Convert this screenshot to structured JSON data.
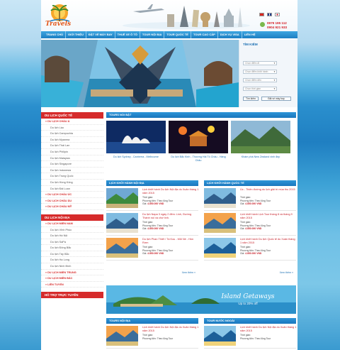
{
  "header": {
    "logo_text": "Travels",
    "hotline": [
      "0979 195 112",
      "0904 921 933"
    ]
  },
  "nav": [
    "TRANG CHỦ",
    "GIỚI THIỆU",
    "ĐẶT VÉ MÁY BAY",
    "THUÊ XE Ô TÔ",
    "TOUR NỘI ĐỊA",
    "TOUR QUỐC TẾ",
    "TOUR CAO CẤP",
    "DỊCH VỤ VISA",
    "LIÊN HỆ"
  ],
  "search": {
    "title": "TÌM KIẾM",
    "selects": [
      "Chọn điểm đi",
      "Chọn điểm khởi hành",
      "Chọn điểm đến",
      "Chọn thời gian"
    ],
    "search_label": "Tìm kiếm",
    "book_label": "Đặt vé máy bay"
  },
  "sidebar": {
    "international_title": "DU LỊCH QUỐC TẾ",
    "international": [
      {
        "label": "DU LỊCH CHÂU Á",
        "cat": true
      },
      {
        "label": "Du lịch Lào"
      },
      {
        "label": "Du lịch Campuchia"
      },
      {
        "label": "Du lịch Myanma"
      },
      {
        "label": "Du lịch Thái Lan"
      },
      {
        "label": "Du lịch Philipin"
      },
      {
        "label": "Du lịch Malaysia"
      },
      {
        "label": "Du lịch Singapore"
      },
      {
        "label": "Du lịch Indonesia"
      },
      {
        "label": "Du lịch Trung Quốc"
      },
      {
        "label": "Du lịch Hồng Kông"
      },
      {
        "label": "Du lịch Đài Loan"
      },
      {
        "label": "DU LỊCH CHÂU ÚC",
        "cat": true
      },
      {
        "label": "DU LỊCH CHÂU ÂU",
        "cat": true
      },
      {
        "label": "DU LỊCH CHÂU MỸ",
        "cat": true
      }
    ],
    "domestic_title": "DU LỊCH NỘI ĐỊA",
    "domestic": [
      {
        "label": "DU LỊCH MIỀN NAM",
        "cat": true
      },
      {
        "label": "Du lịch Vĩnh Phúc"
      },
      {
        "label": "Du lịch Hà Nội"
      },
      {
        "label": "Du lịch SaPa"
      },
      {
        "label": "Du lịch Đông Bắc"
      },
      {
        "label": "Du lịch Tây Bắc"
      },
      {
        "label": "Du lịch Hạ Long"
      },
      {
        "label": "Du lịch Ninh Bình"
      },
      {
        "label": "DU LỊCH MIỀN TRUNG",
        "cat": true
      },
      {
        "label": "DU LỊCH MIỀN BẮC",
        "cat": true
      },
      {
        "label": "LIÊN TUYẾN",
        "cat": true
      }
    ],
    "support_title": "HỖ TRỢ TRỰC TUYẾN"
  },
  "hot": {
    "title": "TOURS NỔI BẬT",
    "items": [
      {
        "caption": "Du lịch Sydney - Canberra - Melbourne"
      },
      {
        "caption": "Du lịch Bắc Kinh - Thượng Hải Tô Châu - Hàng Châu"
      },
      {
        "caption": "Khám phá New Zealand xinh đẹp"
      }
    ]
  },
  "col_left": {
    "title": "LỊCH KHỞI HÀNH NỘI ĐỊA",
    "items": [
      {
        "title": "Lịch khởi hành Du lịch Nội địa du Xuân tháng 1 năm 2015",
        "time": "Thời gian:",
        "transport": "Phương tiện: Theo lũng Tour",
        "price": "4.850.000 VND"
      },
      {
        "title": "Du lịch Napa 3 ngày 2 đêm: Linh, Đường Thành núi và chợ tình.",
        "time": "Thời gian:",
        "transport": "Phương tiện: Theo lũng Tour",
        "price": "4.850.000 VND"
      },
      {
        "title": "Du lịch Phan Thiết / Tà Kou - Mũi Né - Hòn Rơm",
        "time": "Thời gian:",
        "transport": "Phương tiện: Theo lũng Tour",
        "price": "4.850.000 VND"
      }
    ],
    "more": "Xem thêm »"
  },
  "col_right": {
    "title": "LỊCH KHỞI HÀNH QUỐC TẾ",
    "items": [
      {
        "title": "Úc - Thiên đường du lịch giải trí mùa thu 2015",
        "time": "Thời gian:",
        "transport": "Phương tiện: Theo lũng Tour",
        "price": "4.850.000 VND"
      },
      {
        "title": "Lịch khởi hành Lịch Tour tháng 8 và tháng 9 năm 2015",
        "time": "Thời gian:",
        "transport": "Phương tiện: Theo lũng Tour",
        "price": "4.850.000 VND"
      },
      {
        "title": "Lịch khởi hành Du lịch Quốc tế du Xuân tháng 1 năm 2015",
        "time": "Thời gian:",
        "transport": "Phương tiện: Theo lũng Tour",
        "price": "4.850.000 VND"
      }
    ],
    "more": "Xem thêm »"
  },
  "ad": {
    "title": "Island Getaways",
    "subtitle": "Up to 20% off"
  },
  "bottom_left": {
    "title": "TOURS NỘI ĐỊA",
    "items": [
      {
        "title": "Lịch khởi hành Du lịch Nội địa du Xuân tháng 1 năm 2015",
        "time": "Thời gian:",
        "transport": "Phương tiện: Theo lũng Tour"
      }
    ]
  },
  "bottom_right": {
    "title": "TOUR NƯỚC NGOÀI",
    "items": [
      {
        "title": "Lịch khởi hành Du lịch Nội địa du Xuân tháng 1 năm 2015",
        "time": "Thời gian:",
        "transport": "Phương tiện: Theo lũng Tour"
      }
    ]
  },
  "colors": {
    "primary": "#1c7fc3",
    "accent": "#d62b2b",
    "price": "#c8232c"
  }
}
